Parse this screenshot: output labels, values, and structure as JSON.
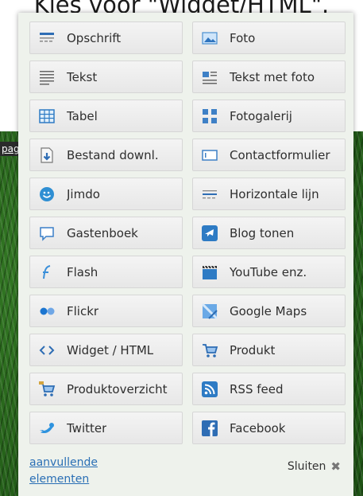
{
  "caption": "Kies voor \"Widget/HTML\".",
  "background": {
    "link_text": "pag"
  },
  "panel": {
    "left_column": [
      {
        "label": "Opschrift",
        "icon": "heading-icon"
      },
      {
        "label": "Tekst",
        "icon": "text-icon"
      },
      {
        "label": "Tabel",
        "icon": "table-icon"
      },
      {
        "label": "Bestand downl.",
        "icon": "file-download-icon"
      },
      {
        "label": "Jimdo",
        "icon": "jimdo-icon"
      },
      {
        "label": "Gastenboek",
        "icon": "guestbook-icon"
      },
      {
        "label": "Flash",
        "icon": "flash-icon"
      },
      {
        "label": "Flickr",
        "icon": "flickr-icon"
      },
      {
        "label": "Widget / HTML",
        "icon": "code-icon"
      },
      {
        "label": "Produktoverzicht",
        "icon": "product-overview-icon"
      },
      {
        "label": "Twitter",
        "icon": "twitter-icon"
      }
    ],
    "right_column": [
      {
        "label": "Foto",
        "icon": "photo-icon"
      },
      {
        "label": "Tekst met foto",
        "icon": "text-with-photo-icon"
      },
      {
        "label": "Fotogalerij",
        "icon": "gallery-icon"
      },
      {
        "label": "Contactformulier",
        "icon": "contact-form-icon"
      },
      {
        "label": "Horizontale lijn",
        "icon": "horizontal-line-icon"
      },
      {
        "label": "Blog tonen",
        "icon": "blog-icon"
      },
      {
        "label": "YouTube enz.",
        "icon": "video-icon"
      },
      {
        "label": "Google Maps",
        "icon": "map-icon"
      },
      {
        "label": "Produkt",
        "icon": "cart-icon"
      },
      {
        "label": "RSS feed",
        "icon": "rss-icon"
      },
      {
        "label": "Facebook",
        "icon": "facebook-icon"
      }
    ],
    "footer": {
      "more_link": "aanvullende elementen",
      "close_label": "Sluiten",
      "close_symbol": "✖"
    }
  }
}
